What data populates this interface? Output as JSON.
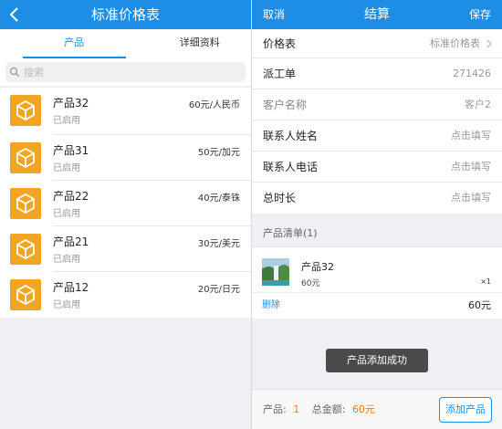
{
  "left": {
    "title": "标准价格表",
    "tabs": [
      {
        "label": "产品"
      },
      {
        "label": "详细资料"
      }
    ],
    "search": {
      "placeholder": "搜索"
    },
    "products": [
      {
        "name": "产品32",
        "status": "已启用",
        "price": "60元/人民币"
      },
      {
        "name": "产品31",
        "status": "已启用",
        "price": "50元/加元"
      },
      {
        "name": "产品22",
        "status": "已启用",
        "price": "40元/泰铢"
      },
      {
        "name": "产品21",
        "status": "已启用",
        "price": "30元/美元"
      },
      {
        "name": "产品12",
        "status": "已启用",
        "price": "20元/日元"
      }
    ]
  },
  "right": {
    "cancel": "取消",
    "title": "结算",
    "save": "保存",
    "fields": [
      {
        "label": "价格表",
        "value": "标准价格表"
      },
      {
        "label": "派工单",
        "value": "271426"
      },
      {
        "label": "客户名称",
        "value": "客户2"
      },
      {
        "label": "联系人姓名",
        "value": "点击填写"
      },
      {
        "label": "联系人电话",
        "value": "点击填写"
      },
      {
        "label": "总时长",
        "value": "点击填写"
      }
    ],
    "section_title": "产品清单(1)",
    "cart_item": {
      "name": "产品32",
      "price": "60元",
      "qty": "×1"
    },
    "delete": "删除",
    "subtotal": "60元",
    "toast": "产品添加成功",
    "footer": {
      "count_label": "产品:",
      "count_value": "1",
      "amount_label": "总金额:",
      "amount_value": "60元",
      "add_button": "添加产品"
    }
  },
  "colors": {
    "primary": "#1e8de6",
    "icon": "#f2a523",
    "accent": "#ef7b1b"
  }
}
